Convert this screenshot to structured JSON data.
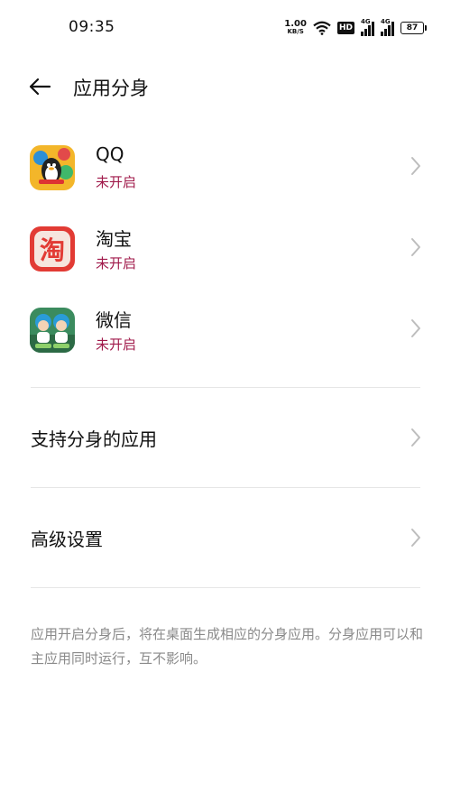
{
  "status_bar": {
    "time": "09:35",
    "net_speed_value": "1.00",
    "net_speed_unit": "KB/S",
    "hd_label": "HD",
    "sim1_label": "4G",
    "sim2_label": "4G",
    "battery": "87"
  },
  "header": {
    "title": "应用分身"
  },
  "apps": [
    {
      "name": "QQ",
      "status": "未开启",
      "icon": "qq-icon"
    },
    {
      "name": "淘宝",
      "status": "未开启",
      "icon": "taobao-icon",
      "icon_glyph": "淘"
    },
    {
      "name": "微信",
      "status": "未开启",
      "icon": "wechat-icon"
    }
  ],
  "menu": {
    "supported_apps": "支持分身的应用",
    "advanced_settings": "高级设置"
  },
  "footnote": "应用开启分身后，将在桌面生成相应的分身应用。分身应用可以和主应用同时运行，互不影响。",
  "colors": {
    "status_off": "#a0194a",
    "taobao_red": "#e23b34",
    "divider": "#e6e6e6"
  }
}
